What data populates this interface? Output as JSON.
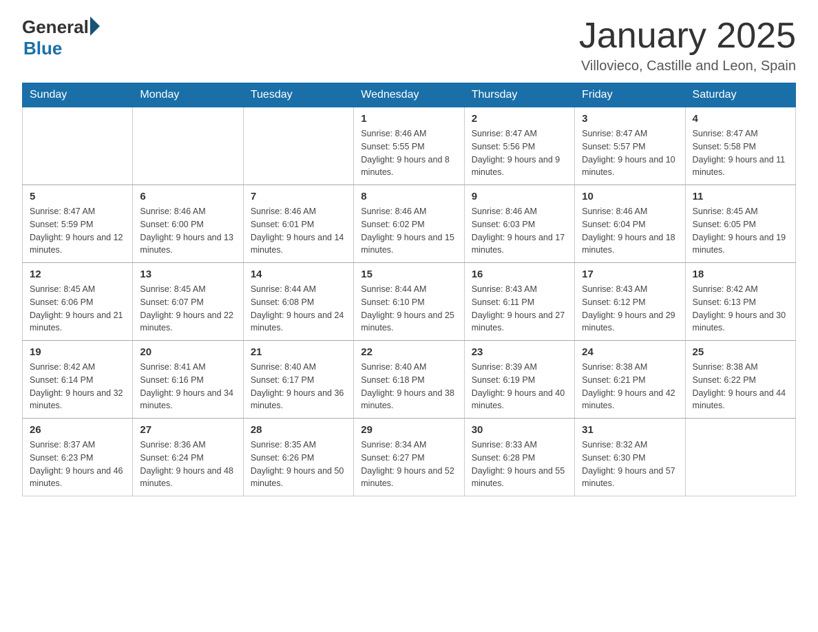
{
  "logo": {
    "general": "General",
    "blue": "Blue"
  },
  "header": {
    "title": "January 2025",
    "subtitle": "Villovieco, Castille and Leon, Spain"
  },
  "days": [
    "Sunday",
    "Monday",
    "Tuesday",
    "Wednesday",
    "Thursday",
    "Friday",
    "Saturday"
  ],
  "weeks": [
    [
      {
        "day": "",
        "info": ""
      },
      {
        "day": "",
        "info": ""
      },
      {
        "day": "",
        "info": ""
      },
      {
        "day": "1",
        "info": "Sunrise: 8:46 AM\nSunset: 5:55 PM\nDaylight: 9 hours\nand 8 minutes."
      },
      {
        "day": "2",
        "info": "Sunrise: 8:47 AM\nSunset: 5:56 PM\nDaylight: 9 hours\nand 9 minutes."
      },
      {
        "day": "3",
        "info": "Sunrise: 8:47 AM\nSunset: 5:57 PM\nDaylight: 9 hours\nand 10 minutes."
      },
      {
        "day": "4",
        "info": "Sunrise: 8:47 AM\nSunset: 5:58 PM\nDaylight: 9 hours\nand 11 minutes."
      }
    ],
    [
      {
        "day": "5",
        "info": "Sunrise: 8:47 AM\nSunset: 5:59 PM\nDaylight: 9 hours\nand 12 minutes."
      },
      {
        "day": "6",
        "info": "Sunrise: 8:46 AM\nSunset: 6:00 PM\nDaylight: 9 hours\nand 13 minutes."
      },
      {
        "day": "7",
        "info": "Sunrise: 8:46 AM\nSunset: 6:01 PM\nDaylight: 9 hours\nand 14 minutes."
      },
      {
        "day": "8",
        "info": "Sunrise: 8:46 AM\nSunset: 6:02 PM\nDaylight: 9 hours\nand 15 minutes."
      },
      {
        "day": "9",
        "info": "Sunrise: 8:46 AM\nSunset: 6:03 PM\nDaylight: 9 hours\nand 17 minutes."
      },
      {
        "day": "10",
        "info": "Sunrise: 8:46 AM\nSunset: 6:04 PM\nDaylight: 9 hours\nand 18 minutes."
      },
      {
        "day": "11",
        "info": "Sunrise: 8:45 AM\nSunset: 6:05 PM\nDaylight: 9 hours\nand 19 minutes."
      }
    ],
    [
      {
        "day": "12",
        "info": "Sunrise: 8:45 AM\nSunset: 6:06 PM\nDaylight: 9 hours\nand 21 minutes."
      },
      {
        "day": "13",
        "info": "Sunrise: 8:45 AM\nSunset: 6:07 PM\nDaylight: 9 hours\nand 22 minutes."
      },
      {
        "day": "14",
        "info": "Sunrise: 8:44 AM\nSunset: 6:08 PM\nDaylight: 9 hours\nand 24 minutes."
      },
      {
        "day": "15",
        "info": "Sunrise: 8:44 AM\nSunset: 6:10 PM\nDaylight: 9 hours\nand 25 minutes."
      },
      {
        "day": "16",
        "info": "Sunrise: 8:43 AM\nSunset: 6:11 PM\nDaylight: 9 hours\nand 27 minutes."
      },
      {
        "day": "17",
        "info": "Sunrise: 8:43 AM\nSunset: 6:12 PM\nDaylight: 9 hours\nand 29 minutes."
      },
      {
        "day": "18",
        "info": "Sunrise: 8:42 AM\nSunset: 6:13 PM\nDaylight: 9 hours\nand 30 minutes."
      }
    ],
    [
      {
        "day": "19",
        "info": "Sunrise: 8:42 AM\nSunset: 6:14 PM\nDaylight: 9 hours\nand 32 minutes."
      },
      {
        "day": "20",
        "info": "Sunrise: 8:41 AM\nSunset: 6:16 PM\nDaylight: 9 hours\nand 34 minutes."
      },
      {
        "day": "21",
        "info": "Sunrise: 8:40 AM\nSunset: 6:17 PM\nDaylight: 9 hours\nand 36 minutes."
      },
      {
        "day": "22",
        "info": "Sunrise: 8:40 AM\nSunset: 6:18 PM\nDaylight: 9 hours\nand 38 minutes."
      },
      {
        "day": "23",
        "info": "Sunrise: 8:39 AM\nSunset: 6:19 PM\nDaylight: 9 hours\nand 40 minutes."
      },
      {
        "day": "24",
        "info": "Sunrise: 8:38 AM\nSunset: 6:21 PM\nDaylight: 9 hours\nand 42 minutes."
      },
      {
        "day": "25",
        "info": "Sunrise: 8:38 AM\nSunset: 6:22 PM\nDaylight: 9 hours\nand 44 minutes."
      }
    ],
    [
      {
        "day": "26",
        "info": "Sunrise: 8:37 AM\nSunset: 6:23 PM\nDaylight: 9 hours\nand 46 minutes."
      },
      {
        "day": "27",
        "info": "Sunrise: 8:36 AM\nSunset: 6:24 PM\nDaylight: 9 hours\nand 48 minutes."
      },
      {
        "day": "28",
        "info": "Sunrise: 8:35 AM\nSunset: 6:26 PM\nDaylight: 9 hours\nand 50 minutes."
      },
      {
        "day": "29",
        "info": "Sunrise: 8:34 AM\nSunset: 6:27 PM\nDaylight: 9 hours\nand 52 minutes."
      },
      {
        "day": "30",
        "info": "Sunrise: 8:33 AM\nSunset: 6:28 PM\nDaylight: 9 hours\nand 55 minutes."
      },
      {
        "day": "31",
        "info": "Sunrise: 8:32 AM\nSunset: 6:30 PM\nDaylight: 9 hours\nand 57 minutes."
      },
      {
        "day": "",
        "info": ""
      }
    ]
  ]
}
